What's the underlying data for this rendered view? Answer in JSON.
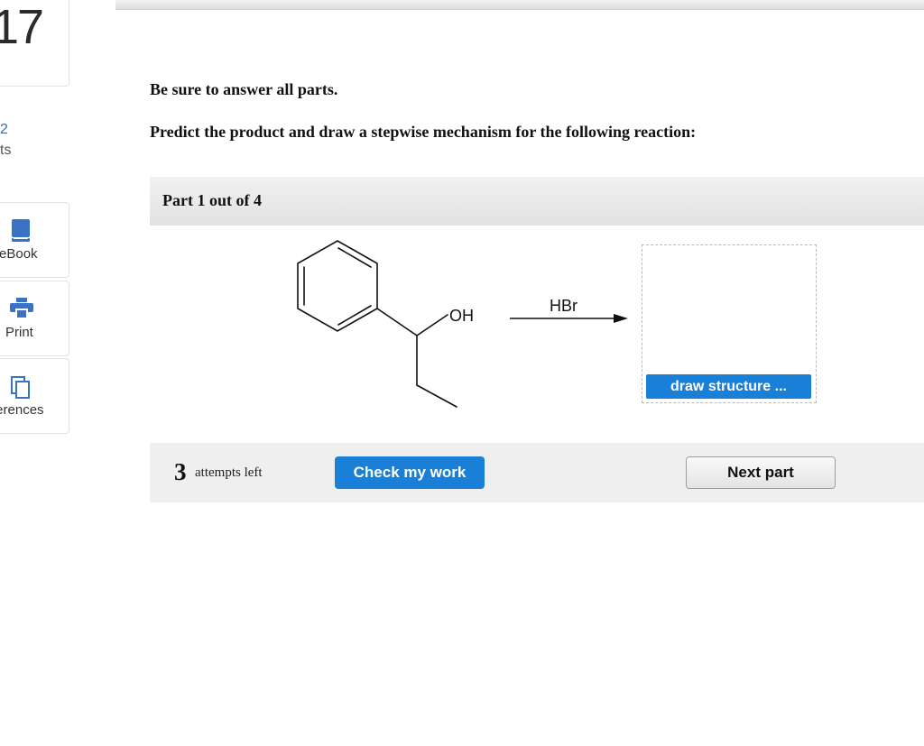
{
  "sidebar": {
    "question_number": "17",
    "points_value": "2",
    "points_label": "ts",
    "tools": [
      {
        "label": "eBook",
        "icon": "book-icon"
      },
      {
        "label": "Print",
        "icon": "printer-icon"
      },
      {
        "label": "ferences",
        "icon": "references-icon"
      }
    ]
  },
  "question": {
    "instruction": "Be sure to answer all parts.",
    "prompt": "Predict the product and draw a stepwise mechanism for the following reaction:"
  },
  "part": {
    "title": "Part 1 out of 4"
  },
  "reaction": {
    "substituent_label": "OH",
    "reagent": "HBr",
    "draw_button_label": "draw structure ..."
  },
  "footer": {
    "attempts_count": "3",
    "attempts_label": "attempts left",
    "check_label": "Check my work",
    "next_label": "Next part"
  },
  "colors": {
    "primary_button": "#1a7fd6",
    "link_blue": "#2a6ebb",
    "icon_blue": "#3a73c6"
  }
}
